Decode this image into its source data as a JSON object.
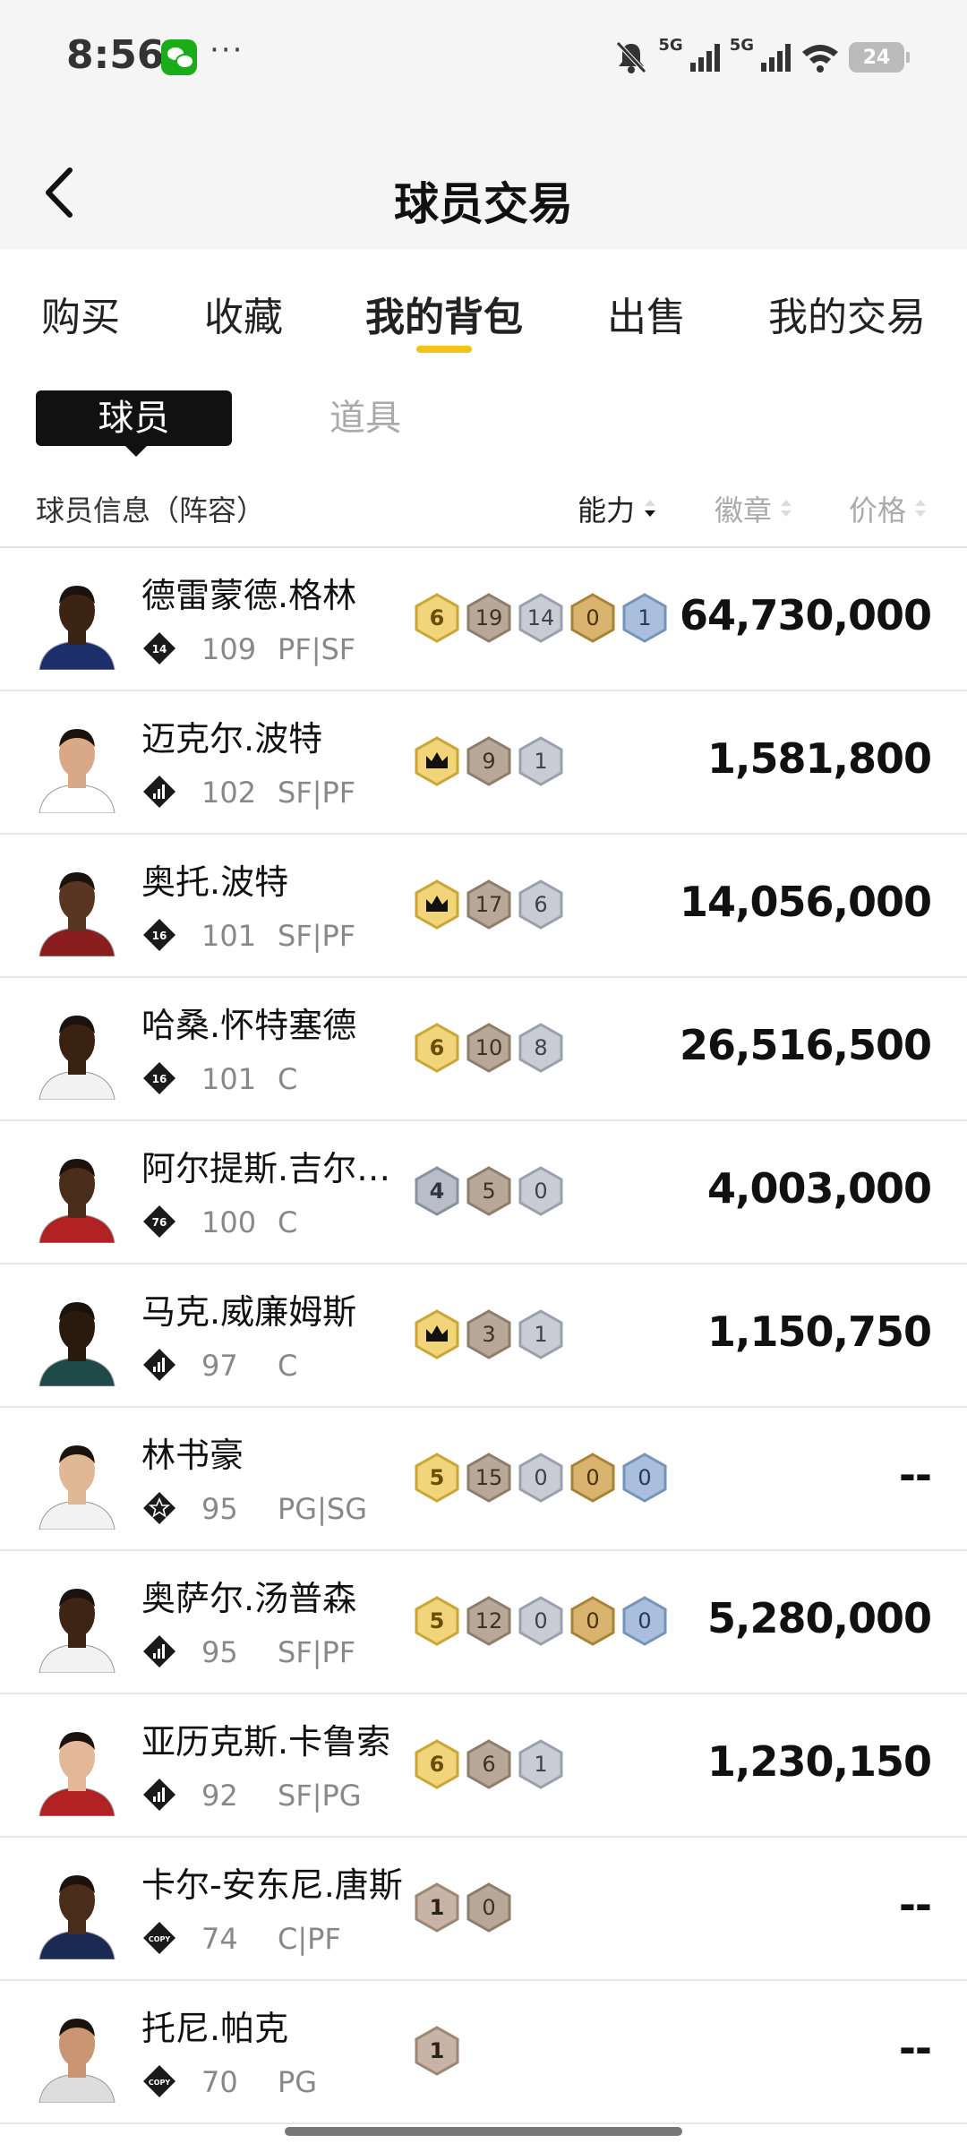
{
  "status_bar": {
    "time": "8:56",
    "more": "···",
    "signal_1": "5G",
    "signal_2": "5G",
    "battery": "24"
  },
  "nav": {
    "title": "球员交易",
    "back_icon": "chevron-left-icon"
  },
  "tabs": [
    {
      "label": "购买"
    },
    {
      "label": "收藏"
    },
    {
      "label": "我的背包"
    },
    {
      "label": "出售"
    },
    {
      "label": "我的交易"
    }
  ],
  "active_tab": "我的背包",
  "sub_tabs": {
    "player": "球员",
    "item": "道具"
  },
  "columns": {
    "info": "球员信息（阵容）",
    "ability": "能力",
    "badge": "徽章",
    "price": "价格"
  },
  "colors": {
    "accent": "#f0c419",
    "gold_hex": "#f2d57a",
    "bronze_hex": "#b8a898",
    "silver_hex": "#c5c8d0",
    "hof_hex": "#d4b070",
    "blue_hex": "#9fb5d4"
  },
  "players": [
    {
      "name": "德雷蒙德.格林",
      "tier": "14",
      "rating": "109",
      "position": "PF|SF",
      "price": "64,730,000",
      "skin": "#3b2414",
      "jersey": "#1d2f6b",
      "badges": [
        {
          "type": "gold",
          "text": "6"
        },
        {
          "type": "bronze",
          "text": "19"
        },
        {
          "type": "silver",
          "text": "14"
        },
        {
          "type": "hof",
          "text": "0"
        },
        {
          "type": "blue",
          "text": "1"
        }
      ]
    },
    {
      "name": "迈克尔.波特",
      "tier": "bars",
      "rating": "102",
      "position": "SF|PF",
      "price": "1,581,800",
      "skin": "#d9a987",
      "jersey": "#ffffff",
      "badges": [
        {
          "type": "crown",
          "text": ""
        },
        {
          "type": "bronze",
          "text": "9"
        },
        {
          "type": "silver",
          "text": "1"
        }
      ]
    },
    {
      "name": "奥托.波特",
      "tier": "16",
      "rating": "101",
      "position": "SF|PF",
      "price": "14,056,000",
      "skin": "#5a3522",
      "jersey": "#8a1e1e",
      "badges": [
        {
          "type": "crown",
          "text": ""
        },
        {
          "type": "bronze",
          "text": "17"
        },
        {
          "type": "silver",
          "text": "6"
        }
      ]
    },
    {
      "name": "哈桑.怀特塞德",
      "tier": "16",
      "rating": "101",
      "position": "C",
      "price": "26,516,500",
      "skin": "#3a2212",
      "jersey": "#f2f2f2",
      "badges": [
        {
          "type": "gold",
          "text": "6"
        },
        {
          "type": "bronze",
          "text": "10"
        },
        {
          "type": "silver",
          "text": "8"
        }
      ]
    },
    {
      "name": "阿尔提斯.吉尔…",
      "tier": "76",
      "rating": "100",
      "position": "C",
      "price": "4,003,000",
      "skin": "#4a2c1a",
      "jersey": "#b22222",
      "badges": [
        {
          "type": "silverdark",
          "text": "4"
        },
        {
          "type": "bronze",
          "text": "5"
        },
        {
          "type": "silver",
          "text": "0"
        }
      ]
    },
    {
      "name": "马克.威廉姆斯",
      "tier": "bars",
      "rating": "97",
      "position": "C",
      "price": "1,150,750",
      "skin": "#2a1a0e",
      "jersey": "#1f4a4a",
      "badges": [
        {
          "type": "crown",
          "text": ""
        },
        {
          "type": "bronze",
          "text": "3"
        },
        {
          "type": "silver",
          "text": "1"
        }
      ]
    },
    {
      "name": "林书豪",
      "tier": "star",
      "rating": "95",
      "position": "PG|SG",
      "price": "--",
      "skin": "#e0b896",
      "jersey": "#f2f2f2",
      "badges": [
        {
          "type": "gold",
          "text": "5"
        },
        {
          "type": "bronze",
          "text": "15"
        },
        {
          "type": "silver",
          "text": "0"
        },
        {
          "type": "hof",
          "text": "0"
        },
        {
          "type": "blue",
          "text": "0"
        }
      ]
    },
    {
      "name": "奥萨尔.汤普森",
      "tier": "bars",
      "rating": "95",
      "position": "SF|PF",
      "price": "5,280,000",
      "skin": "#3d2414",
      "jersey": "#f2f2f2",
      "badges": [
        {
          "type": "gold",
          "text": "5"
        },
        {
          "type": "bronze",
          "text": "12"
        },
        {
          "type": "silver",
          "text": "0"
        },
        {
          "type": "hof",
          "text": "0"
        },
        {
          "type": "blue",
          "text": "0"
        }
      ]
    },
    {
      "name": "亚历克斯.卡鲁索",
      "tier": "bars",
      "rating": "92",
      "position": "SF|PG",
      "price": "1,230,150",
      "skin": "#e2b898",
      "jersey": "#b22222",
      "badges": [
        {
          "type": "gold",
          "text": "6"
        },
        {
          "type": "bronze",
          "text": "6"
        },
        {
          "type": "silver",
          "text": "1"
        }
      ]
    },
    {
      "name": "卡尔-安东尼.唐斯",
      "tier": "copy",
      "rating": "74",
      "position": "C|PF",
      "price": "--",
      "skin": "#4a2c1a",
      "jersey": "#1a2a52",
      "badges": [
        {
          "type": "bronzelight",
          "text": "1"
        },
        {
          "type": "bronze",
          "text": "0"
        }
      ]
    },
    {
      "name": "托尼.帕克",
      "tier": "copy",
      "rating": "70",
      "position": "PG",
      "price": "--",
      "skin": "#c99572",
      "jersey": "#dddddd",
      "badges": [
        {
          "type": "bronzelight",
          "text": "1"
        }
      ]
    }
  ]
}
